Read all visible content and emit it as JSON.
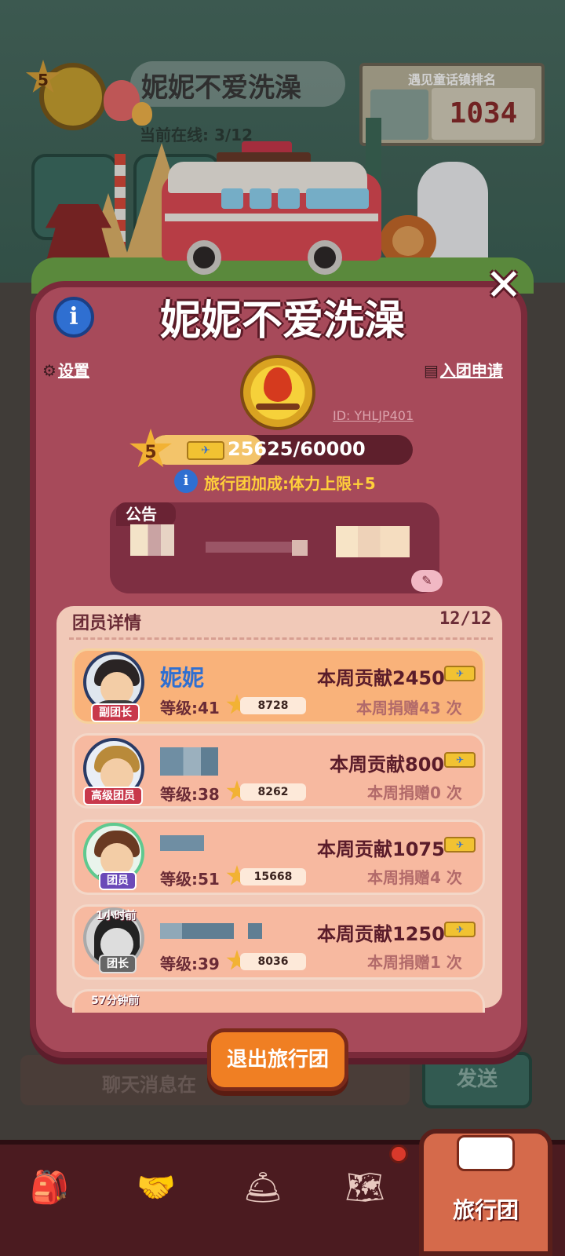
{
  "background": {
    "team_level": "5",
    "team_name": "妮妮不爱洗澡",
    "online_label": "当前在线: 3/12",
    "ranking_title": "遇见童话镇排名",
    "ranking_value": "1034",
    "bus_button_label": "旅",
    "chat_placeholder": "聊天消息在",
    "send_label": "发送"
  },
  "modal": {
    "title": "妮妮不爱洗澡",
    "settings_label": "设置",
    "apply_label": "入团申请",
    "team_id": "ID: YHLJP401",
    "level": "5",
    "xp_text": "25625/60000",
    "xp_progress": 0.427,
    "bonus_text": "旅行团加成:体力上限+5",
    "notice_label": "公告",
    "members_title": "团员详情",
    "members_count": "12/12",
    "exit_label": "退出旅行团"
  },
  "members": [
    {
      "name": "妮妮",
      "role": "副团长",
      "level": "等级:41",
      "points": "8728",
      "weekly": "本周贡献2450",
      "donations": "本周捐赠43 次",
      "time": ""
    },
    {
      "name": "",
      "role": "高级团员",
      "level": "等级:38",
      "points": "8262",
      "weekly": "本周贡献800",
      "donations": "本周捐赠0 次",
      "time": ""
    },
    {
      "name": "",
      "role": "团员",
      "level": "等级:51",
      "points": "15668",
      "weekly": "本周贡献1075",
      "donations": "本周捐赠4 次",
      "time": ""
    },
    {
      "name": "",
      "role": "团长",
      "level": "等级:39",
      "points": "8036",
      "weekly": "本周贡献1250",
      "donations": "本周捐赠1 次",
      "time": "1小时前"
    }
  ],
  "next_member_time": "57分钟前",
  "nav": {
    "active_label": "旅行团",
    "items": [
      "bag-icon",
      "handshake-icon",
      "bell-icon",
      "map-icon"
    ]
  },
  "colors": {
    "modal_bg": "#a74a5a",
    "accent_orange": "#f07f23",
    "name_blue": "#2f6fd1",
    "gold": "#f2b234"
  }
}
